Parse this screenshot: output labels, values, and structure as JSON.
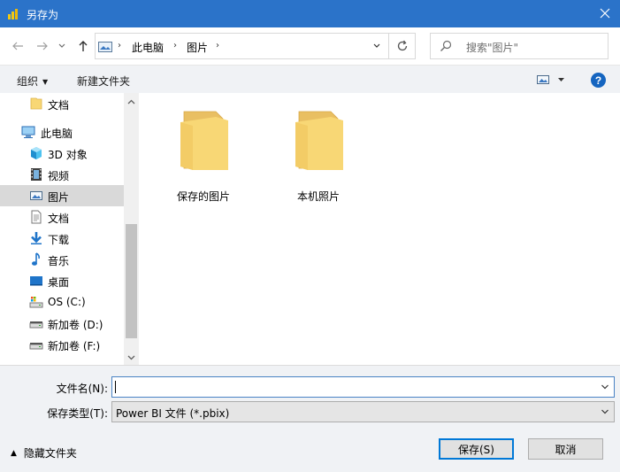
{
  "window": {
    "title": "另存为",
    "accent_color": "#2b73c9"
  },
  "nav": {
    "back_icon": "arrow-left",
    "forward_icon": "arrow-right",
    "recent_icon": "chevron-down",
    "up_icon": "arrow-up"
  },
  "address": {
    "crumbs": [
      "此电脑",
      "图片"
    ],
    "separator": "›"
  },
  "search": {
    "placeholder": "搜索\"图片\""
  },
  "toolbar": {
    "organize_label": "组织",
    "new_folder_label": "新建文件夹",
    "help_label": "?"
  },
  "sidebar": {
    "items": [
      {
        "label": "文档",
        "icon": "folder-icon"
      },
      {
        "label": "此电脑",
        "icon": "computer-icon"
      },
      {
        "label": "3D 对象",
        "icon": "3d-objects-icon"
      },
      {
        "label": "视频",
        "icon": "video-icon"
      },
      {
        "label": "图片",
        "icon": "pictures-icon"
      },
      {
        "label": "文档",
        "icon": "documents-icon"
      },
      {
        "label": "下载",
        "icon": "download-icon"
      },
      {
        "label": "音乐",
        "icon": "music-icon"
      },
      {
        "label": "桌面",
        "icon": "desktop-icon"
      },
      {
        "label": "OS (C:)",
        "icon": "os-drive-icon"
      },
      {
        "label": "新加卷 (D:)",
        "icon": "drive-icon"
      },
      {
        "label": "新加卷 (F:)",
        "icon": "drive-icon"
      }
    ]
  },
  "content": {
    "folders": [
      {
        "label": "保存的图片"
      },
      {
        "label": "本机照片"
      }
    ]
  },
  "form": {
    "filename_label": "文件名(N):",
    "filename_value": "",
    "filetype_label": "保存类型(T):",
    "filetype_value": "Power BI 文件 (*.pbix)"
  },
  "footer": {
    "hide_folders_label": "隐藏文件夹",
    "save_label": "保存(S)",
    "cancel_label": "取消"
  }
}
